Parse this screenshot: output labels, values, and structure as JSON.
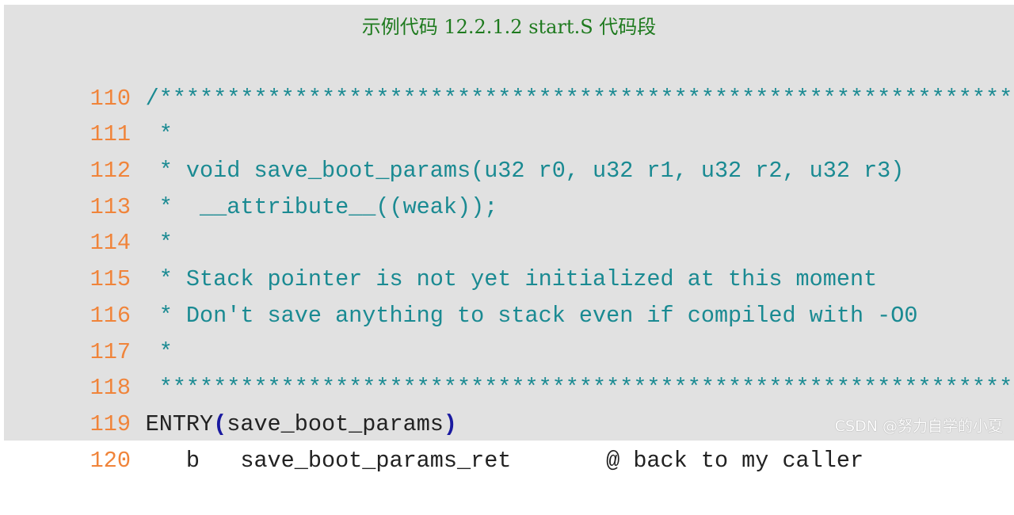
{
  "caption": "示例代码 12.2.1.2 start.S 代码段",
  "colors": {
    "line_number": "#f0843a",
    "comment": "#1a8a92",
    "code": "#222222",
    "paren": "#1a1aa0",
    "caption": "#1e7a1e",
    "background": "#e1e1e1"
  },
  "lines": [
    {
      "number": "110",
      "text": "/******************************************************************",
      "kind": "comment"
    },
    {
      "number": "111",
      "text": " *",
      "kind": "comment"
    },
    {
      "number": "112",
      "text": " * void save_boot_params(u32 r0, u32 r1, u32 r2, u32 r3)",
      "kind": "comment"
    },
    {
      "number": "113",
      "text": " *  __attribute__((weak));",
      "kind": "comment"
    },
    {
      "number": "114",
      "text": " *",
      "kind": "comment"
    },
    {
      "number": "115",
      "text": " * Stack pointer is not yet initialized at this moment",
      "kind": "comment"
    },
    {
      "number": "116",
      "text": " * Don't save anything to stack even if compiled with -O0",
      "kind": "comment"
    },
    {
      "number": "117",
      "text": " *",
      "kind": "comment"
    },
    {
      "number": "118",
      "text": " ***************************************************************/",
      "kind": "comment"
    },
    {
      "number": "119",
      "prefix": "ENTRY",
      "open_paren": "(",
      "arg": "save_boot_params",
      "close_paren": ")",
      "kind": "code"
    },
    {
      "number": "120",
      "text": "   b   save_boot_params_ret       @ back to my caller",
      "kind": "code"
    }
  ],
  "watermark": "CSDN @努力自学的小夏"
}
